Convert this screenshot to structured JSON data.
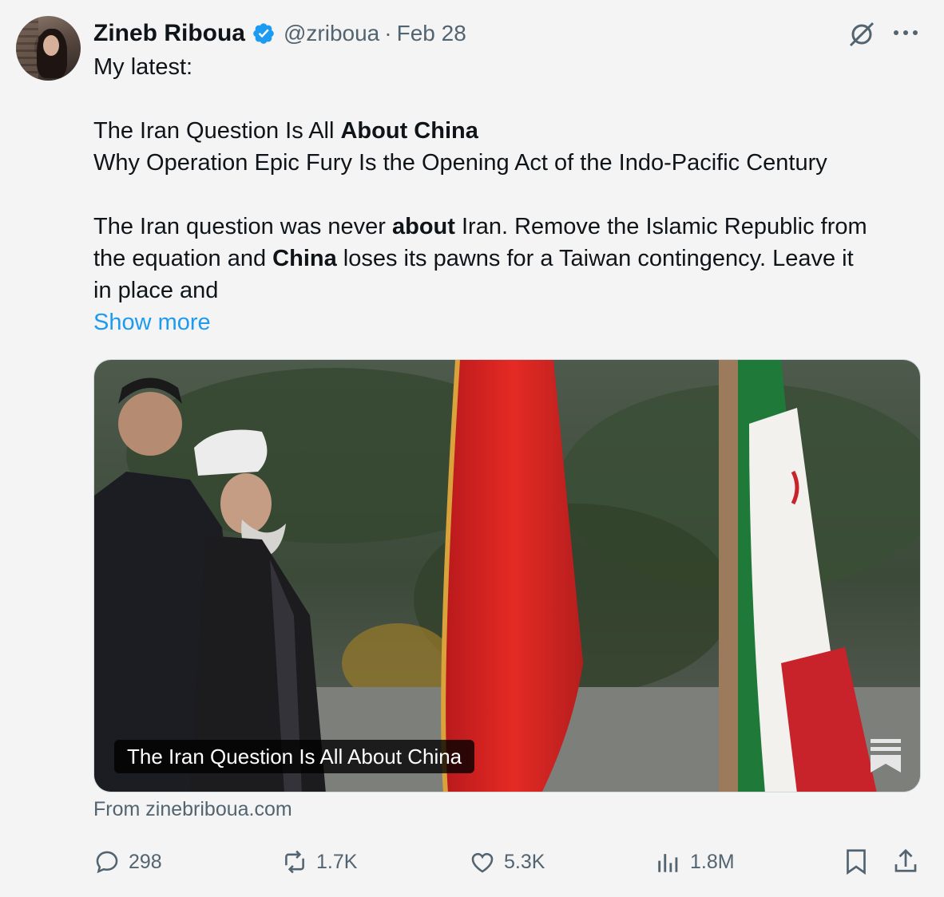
{
  "author": {
    "name": "Zineb Riboua",
    "handle": "@zriboua",
    "separator": "·",
    "date": "Feb 28"
  },
  "tweet": {
    "line1": "My latest:",
    "title_plain": "The Iran Question Is All ",
    "title_bold": "About China",
    "subtitle": "Why Operation Epic Fury Is the Opening Act of the Indo-Pacific Century",
    "p1_a": "The Iran question was never ",
    "p1_b": "about",
    "p1_c": " Iran. Remove the Islamic Republic from",
    "p2_a": "the equation and ",
    "p2_b": "China",
    "p2_c": " loses its pawns for a Taiwan contingency. Leave it",
    "p3": "in place and",
    "show_more": "Show more"
  },
  "card": {
    "title": "The Iran Question Is All About China",
    "source": "From zinebriboua.com"
  },
  "actions": {
    "replies": "298",
    "reposts": "1.7K",
    "likes": "5.3K",
    "views": "1.8M"
  },
  "icons": {
    "verified": "verified-badge-icon",
    "grok": "grok-icon",
    "more": "more-dots-icon",
    "reply": "reply-icon",
    "repost": "repost-icon",
    "like": "heart-icon",
    "views": "views-icon",
    "bookmark": "bookmark-icon",
    "share": "share-icon",
    "card_source": "substack-icon"
  },
  "colors": {
    "accent": "#1d9bf0",
    "muted": "#536471",
    "text": "#0f1419"
  }
}
